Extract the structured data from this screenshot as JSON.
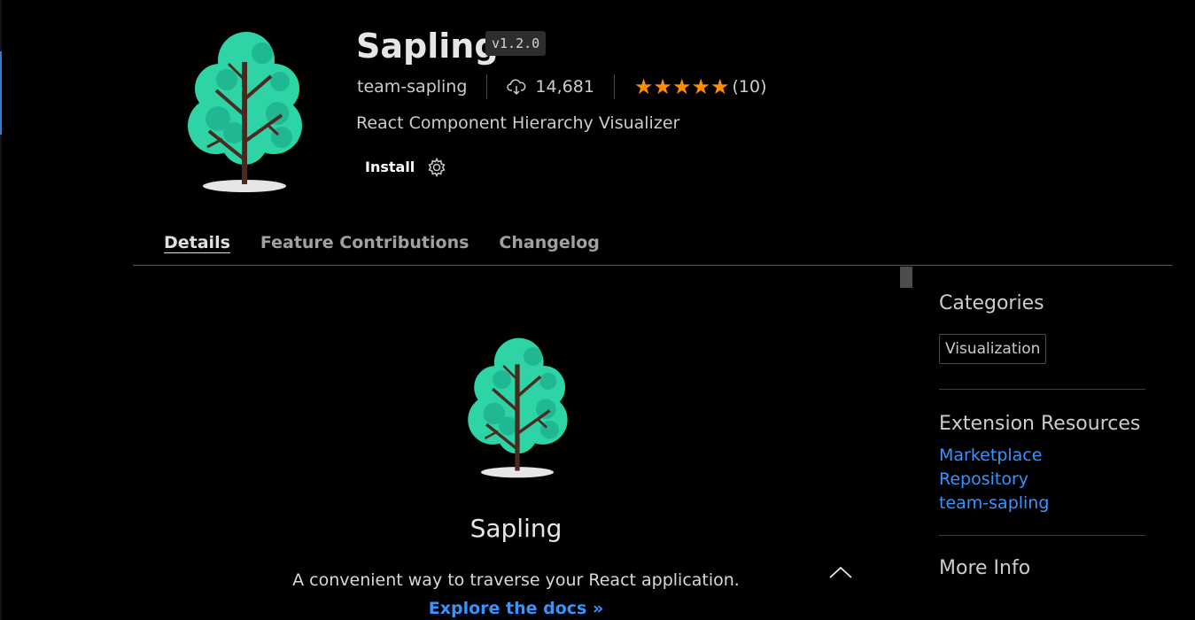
{
  "extension": {
    "name": "Sapling",
    "version": "v1.2.0",
    "publisher": "team-sapling",
    "downloads": "14,681",
    "rating_stars": 5,
    "rating_count": "(10)",
    "description": "React Component Hierarchy Visualizer",
    "install_label": "Install"
  },
  "tabs": [
    {
      "label": "Details",
      "active": true
    },
    {
      "label": "Feature Contributions",
      "active": false
    },
    {
      "label": "Changelog",
      "active": false
    }
  ],
  "readme": {
    "title": "Sapling",
    "description": "A convenient way to traverse your React application.",
    "link_text": "Explore the docs »"
  },
  "sidebar": {
    "categories_heading": "Categories",
    "categories": [
      "Visualization"
    ],
    "resources_heading": "Extension Resources",
    "resources": [
      "Marketplace",
      "Repository",
      "team-sapling"
    ],
    "more_info_heading": "More Info"
  },
  "colors": {
    "background": "#000000",
    "star": "#ff8e00",
    "link": "#3794ff",
    "tree_foliage": "#2fd4a6",
    "tree_trunk": "#4a2a20"
  },
  "icons": [
    "tree-logo-icon",
    "cloud-download-icon",
    "star-icon",
    "gear-icon",
    "chevron-up-icon"
  ]
}
